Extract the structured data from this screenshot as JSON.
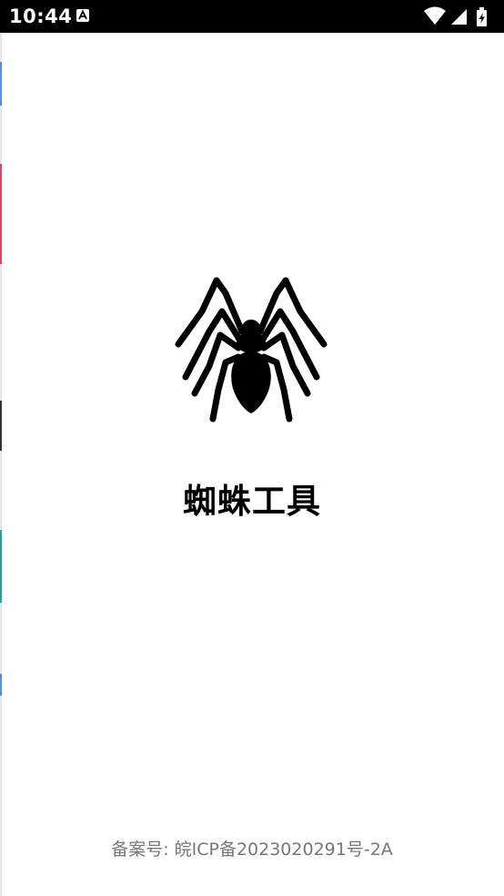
{
  "status_bar": {
    "time": "10:44",
    "notification_icon": "a-badge-icon",
    "icons": [
      "wifi-icon",
      "signal-icon",
      "battery-charging-icon"
    ]
  },
  "splash": {
    "logo_icon": "spider-icon",
    "app_name": "蜘蛛工具"
  },
  "footer": {
    "icp_text": "备案号: 皖ICP备2023020291号-2A"
  },
  "colors": {
    "background": "#ffffff",
    "status_bar": "#000000",
    "footer_text": "#777777"
  }
}
